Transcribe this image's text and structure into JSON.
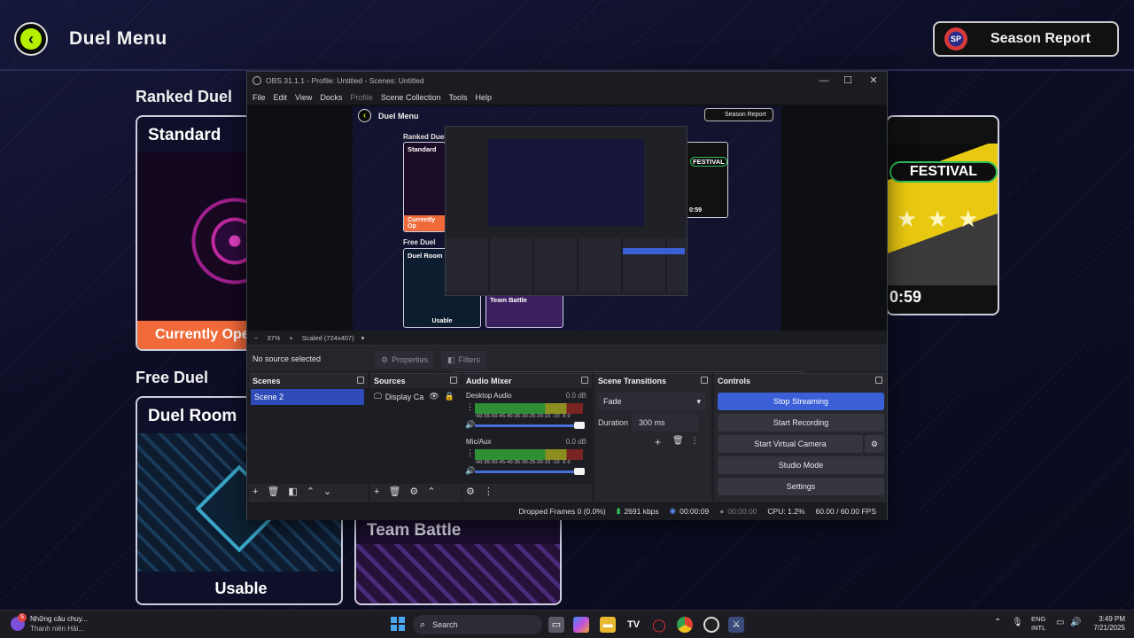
{
  "game": {
    "title": "Duel Menu",
    "season_report": "Season Report",
    "season_icon": "SP",
    "sections": {
      "ranked": "Ranked Duel",
      "free": "Free Duel"
    },
    "cards": {
      "standard": {
        "title": "Standard",
        "badge": "Currently Ope"
      },
      "duel_room": {
        "title": "Duel Room",
        "badge": "Usable"
      },
      "team_battle": {
        "title": "Team Battle"
      },
      "festival": {
        "label": "FESTIVAL",
        "stars": "★ ★ ★",
        "timer": "0:59"
      }
    }
  },
  "obs": {
    "title": "OBS 31.1.1 - Profile: Untitled - Scenes: Untitled",
    "window_controls": {
      "minimize": "—",
      "maximize": "☐",
      "close": "✕"
    },
    "menu": [
      "File",
      "Edit",
      "View",
      "Docks",
      "Profile",
      "Scene Collection",
      "Tools",
      "Help"
    ],
    "preview": {
      "mini": {
        "title": "Duel Menu",
        "season": "Season Report",
        "ranked": "Ranked Duel",
        "standard": "Standard",
        "currently": "Currently Op",
        "free": "Free Duel",
        "duel_room": "Duel Room",
        "usable": "Usable",
        "team_battle": "Team Battle",
        "festival": "FESTIVAL",
        "timer": "0:59"
      }
    },
    "zoom": {
      "minus": "−",
      "value": "37%",
      "plus": "+",
      "scaled": "Scaled (724x407)"
    },
    "source_bar": {
      "no_source": "No source selected",
      "properties": "Properties",
      "filters": "Filters"
    },
    "docks": {
      "scenes": {
        "title": "Scenes",
        "items": [
          "Scene 2"
        ]
      },
      "sources": {
        "title": "Sources",
        "items": [
          "Display Ca"
        ]
      },
      "mixer": {
        "title": "Audio Mixer",
        "channels": [
          {
            "name": "Desktop Audio",
            "db": "0.0 dB"
          },
          {
            "name": "Mic/Aux",
            "db": "0.0 dB"
          }
        ],
        "scale": "-60-55-50-45-40-35-30-25-20-15 -10 -5 0"
      },
      "transitions": {
        "title": "Scene Transitions",
        "type": "Fade",
        "duration_label": "Duration",
        "duration": "300 ms"
      },
      "controls": {
        "title": "Controls",
        "buttons": [
          "Stop Streaming",
          "Start Recording",
          "Start Virtual Camera",
          "Studio Mode",
          "Settings"
        ]
      }
    },
    "status": {
      "dropped": "Dropped Frames 0 (0.0%)",
      "kbps": "2691 kbps",
      "stream_time": "00:00:09",
      "rec_time": "00:00:00",
      "cpu": "CPU: 1.2%",
      "fps": "60.00 / 60.00 FPS"
    }
  },
  "taskbar": {
    "news_title": "Những câu chuy...",
    "news_sub": "Thanh niên Hải...",
    "news_badge": "5",
    "search": "Search",
    "lang_top": "ENG",
    "lang_bottom": "INTL",
    "time": "3:49 PM",
    "date": "7/21/2025"
  }
}
